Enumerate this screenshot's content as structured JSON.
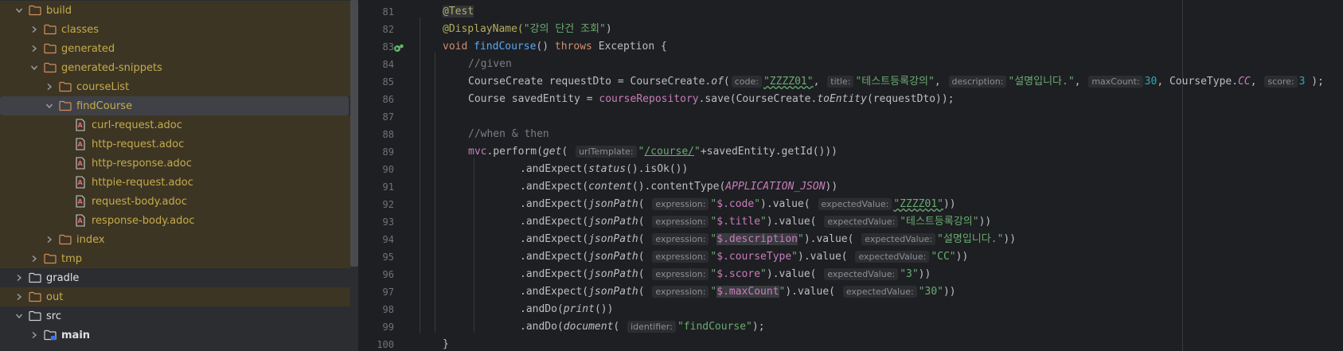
{
  "project_tree": {
    "items": [
      {
        "label": "build",
        "depth": 1,
        "expanded": true,
        "excluded": true,
        "type": "folder"
      },
      {
        "label": "classes",
        "depth": 2,
        "expanded": false,
        "excluded": true,
        "type": "folder"
      },
      {
        "label": "generated",
        "depth": 2,
        "expanded": false,
        "excluded": true,
        "type": "folder"
      },
      {
        "label": "generated-snippets",
        "depth": 2,
        "expanded": true,
        "excluded": true,
        "type": "folder"
      },
      {
        "label": "courseList",
        "depth": 3,
        "expanded": false,
        "excluded": true,
        "type": "folder"
      },
      {
        "label": "findCourse",
        "depth": 3,
        "expanded": true,
        "excluded": true,
        "selected": true,
        "type": "folder"
      },
      {
        "label": "curl-request.adoc",
        "depth": 4,
        "excluded": true,
        "type": "file"
      },
      {
        "label": "http-request.adoc",
        "depth": 4,
        "excluded": true,
        "type": "file"
      },
      {
        "label": "http-response.adoc",
        "depth": 4,
        "excluded": true,
        "type": "file"
      },
      {
        "label": "httpie-request.adoc",
        "depth": 4,
        "excluded": true,
        "type": "file"
      },
      {
        "label": "request-body.adoc",
        "depth": 4,
        "excluded": true,
        "type": "file"
      },
      {
        "label": "response-body.adoc",
        "depth": 4,
        "excluded": true,
        "type": "file"
      },
      {
        "label": "index",
        "depth": 3,
        "expanded": false,
        "excluded": true,
        "type": "folder"
      },
      {
        "label": "tmp",
        "depth": 2,
        "expanded": false,
        "excluded": true,
        "type": "folder"
      },
      {
        "label": "gradle",
        "depth": 1,
        "expanded": false,
        "excluded": false,
        "type": "folder"
      },
      {
        "label": "out",
        "depth": 1,
        "expanded": false,
        "excluded": true,
        "type": "folder"
      },
      {
        "label": "src",
        "depth": 1,
        "expanded": true,
        "excluded": false,
        "type": "folder"
      },
      {
        "label": "main",
        "depth": 2,
        "expanded": false,
        "excluded": false,
        "type": "module"
      }
    ]
  },
  "editor": {
    "line_numbers": [
      "81",
      "82",
      "83",
      "84",
      "85",
      "86",
      "87",
      "88",
      "89",
      "90",
      "91",
      "92",
      "93",
      "94",
      "95",
      "96",
      "97",
      "98",
      "99",
      "100"
    ],
    "code": {
      "l81_ann": "@Test",
      "l82_ann": "@DisplayName(",
      "l82_str": "\"강의 단건 조회\"",
      "l82_end": ")",
      "l83_void": "void ",
      "l83_fn": "findCourse",
      "l83_mid": "() ",
      "l83_throws": "throws",
      "l83_end": " Exception {",
      "l84": "//given",
      "l85_a": "CourseCreate requestDto = CourseCreate.",
      "l85_of": "of",
      "l85_b": "(",
      "l85_h1": "code:",
      "l85_s1": "\"ZZZZ01\"",
      "l85_c1": ", ",
      "l85_h2": "title:",
      "l85_s2": "\"테스트등록강의\"",
      "l85_c2": ", ",
      "l85_h3": "description:",
      "l85_s3": "\"설명입니다.\"",
      "l85_c3": ", ",
      "l85_h4": "maxCount:",
      "l85_n4": "30",
      "l85_c4": ", CourseType.",
      "l85_cc": "CC",
      "l85_c5": ", ",
      "l85_h5": "score:",
      "l85_n5": "3",
      "l85_end": " );",
      "l86_a": "Course savedEntity = ",
      "l86_field": "courseRepository",
      "l86_b": ".save(CourseCreate.",
      "l86_to": "toEntity",
      "l86_c": "(requestDto));",
      "l88": "//when & then",
      "l89_mvc": "mvc",
      "l89_a": ".perform(",
      "l89_get": "get",
      "l89_b": "( ",
      "l89_h": "urlTemplate:",
      "l89_q1": "\"",
      "l89_url": "/course/",
      "l89_q2": "\"",
      "l89_c": "+savedEntity.getId()))",
      "l90_a": ".andExpect(",
      "l90_status": "status",
      "l90_b": "().isOk())",
      "l91_a": ".andExpect(",
      "l91_content": "content",
      "l91_b": "().contentType(",
      "l91_const": "APPLICATION_JSON",
      "l91_c": "))",
      "l92_a": ".andExpect(",
      "l92_jp": "jsonPath",
      "l92_b": "( ",
      "l92_h1": "expression:",
      "l92_q1": "\"",
      "l92_path": "$.code",
      "l92_q2": "\"",
      "l92_c": ").value( ",
      "l92_h2": "expectedValue:",
      "l92_val": "\"ZZZZ01\"",
      "l92_end": "))",
      "l93_a": ".andExpect(",
      "l93_jp": "jsonPath",
      "l93_b": "( ",
      "l93_h1": "expression:",
      "l93_q1": "\"",
      "l93_path": "$.title",
      "l93_q2": "\"",
      "l93_c": ").value( ",
      "l93_h2": "expectedValue:",
      "l93_val": "\"테스트등록강의\"",
      "l93_end": "))",
      "l94_a": ".andExpect(",
      "l94_jp": "jsonPath",
      "l94_b": "( ",
      "l94_h1": "expression:",
      "l94_q1": "\"",
      "l94_path": "$.description",
      "l94_q2": "\"",
      "l94_c": ").value( ",
      "l94_h2": "expectedValue:",
      "l94_val": "\"설명입니다.\"",
      "l94_end": "))",
      "l95_a": ".andExpect(",
      "l95_jp": "jsonPath",
      "l95_b": "( ",
      "l95_h1": "expression:",
      "l95_q1": "\"",
      "l95_path": "$.courseType",
      "l95_q2": "\"",
      "l95_c": ").value( ",
      "l95_h2": "expectedValue:",
      "l95_val": "\"CC\"",
      "l95_end": "))",
      "l96_a": ".andExpect(",
      "l96_jp": "jsonPath",
      "l96_b": "( ",
      "l96_h1": "expression:",
      "l96_q1": "\"",
      "l96_path": "$.score",
      "l96_q2": "\"",
      "l96_c": ").value( ",
      "l96_h2": "expectedValue:",
      "l96_val": "\"3\"",
      "l96_end": "))",
      "l97_a": ".andExpect(",
      "l97_jp": "jsonPath",
      "l97_b": "( ",
      "l97_h1": "expression:",
      "l97_q1": "\"",
      "l97_path": "$.maxCount",
      "l97_q2": "\"",
      "l97_c": ").value( ",
      "l97_h2": "expectedValue:",
      "l97_val": "\"30\"",
      "l97_end": "))",
      "l98_a": ".andDo(",
      "l98_print": "print",
      "l98_b": "())",
      "l99_a": ".andDo(",
      "l99_doc": "document",
      "l99_b": "( ",
      "l99_h": "identifier:",
      "l99_str": "\"findCourse\"",
      "l99_end": ");",
      "l100": "}"
    }
  },
  "colors": {
    "tree_bg": "#2b2d30",
    "excluded_bg": "#3d3523",
    "excluded_text": "#c4ac4b",
    "editor_bg": "#1e1f22",
    "keyword": "#cf8e6d",
    "string": "#6aab73",
    "annotation": "#b3ae60",
    "function": "#56a8f5",
    "field": "#c77dbb",
    "number": "#2aacb8"
  }
}
